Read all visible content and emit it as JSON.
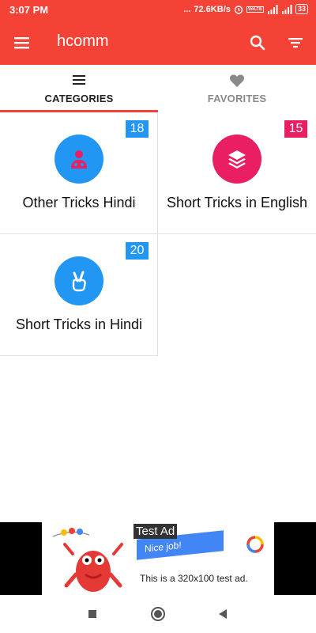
{
  "status_bar": {
    "time": "3:07 PM",
    "dots": "...",
    "network_speed": "72.6KB/s",
    "volte": "VoLTE",
    "battery": "33"
  },
  "app_bar": {
    "title": "hcomm",
    "icons": [
      "menu-icon",
      "search-icon",
      "filter-icon"
    ]
  },
  "tabs": [
    {
      "label": "CATEGORIES",
      "icon": "list-icon",
      "active": true
    },
    {
      "label": "FAVORITES",
      "icon": "heart-icon",
      "active": false
    }
  ],
  "categories": [
    {
      "name": "Other Tricks Hindi",
      "count": "18",
      "icon": "person-badge-icon",
      "circle_color": "#2196f3",
      "badge_color": "#2196f3",
      "icon_color": "#e91e63"
    },
    {
      "name": "Short Tricks in English",
      "count": "15",
      "icon": "layers-icon",
      "circle_color": "#e91e63",
      "badge_color": "#e91e63",
      "icon_color": "#ffffff"
    },
    {
      "name": "Short Tricks in Hindi",
      "count": "20",
      "icon": "peace-hand-icon",
      "circle_color": "#2196f3",
      "badge_color": "#2196f3",
      "icon_color": "#ffffff"
    }
  ],
  "ad": {
    "label": "Test Ad",
    "banner": "Nice job!",
    "text": "This is a 320x100 test ad."
  },
  "colors": {
    "primary": "#f44336",
    "tab_active": "#212121",
    "tab_inactive": "#8a8a8a"
  }
}
